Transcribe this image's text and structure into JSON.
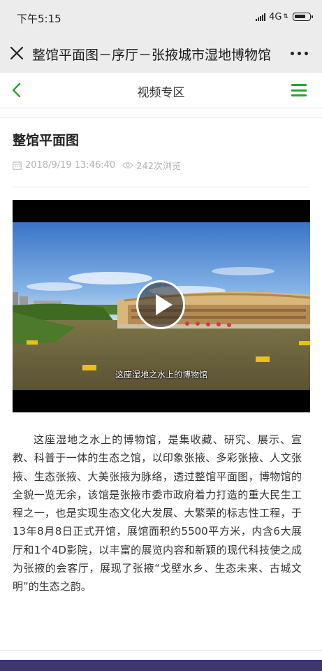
{
  "status_bar": {
    "time": "下午5:15",
    "network": "4G",
    "network_arrows": "⇅",
    "icons": [
      "signal-icon",
      "battery-icon"
    ]
  },
  "title_bar": {
    "title": "整馆平面图－序厅－张掖城市湿地博物馆",
    "icons": [
      "close-icon",
      "more-icon"
    ]
  },
  "section_header": {
    "title": "视频专区",
    "accent_color": "#22a82a",
    "icons": [
      "back-chevron-icon",
      "menu-icon"
    ]
  },
  "article": {
    "title": "整馆平面图",
    "date": "2018/9/19 13:46:40",
    "views": "242次浏览",
    "icons": [
      "calendar-icon",
      "eye-icon"
    ],
    "video": {
      "subtitle": "这座湿地之水上的博物馆",
      "icons": [
        "play-icon"
      ]
    },
    "body": "这座湿地之水上的博物馆，是集收藏、研究、展示、宣教、科普于一体的生态之馆，以印象张掖、多彩张掖、人文张掖、生态张掖、大美张掖为脉络，透过整馆平面图，博物馆的全貌一览无余，该馆是张掖市委市政府着力打造的重大民生工程之一，也是实现生态文化大发展、大繁荣的标志性工程，于13年8月8日正式开馆，展馆面积约5500平方米，内含6大展厅和1个4D影院，以丰富的展览内容和新颖的现代科技使之成为张掖的会客厅，展现了张掖“戈壁水乡、生态未来、古城文明”的生态之韵。"
  }
}
